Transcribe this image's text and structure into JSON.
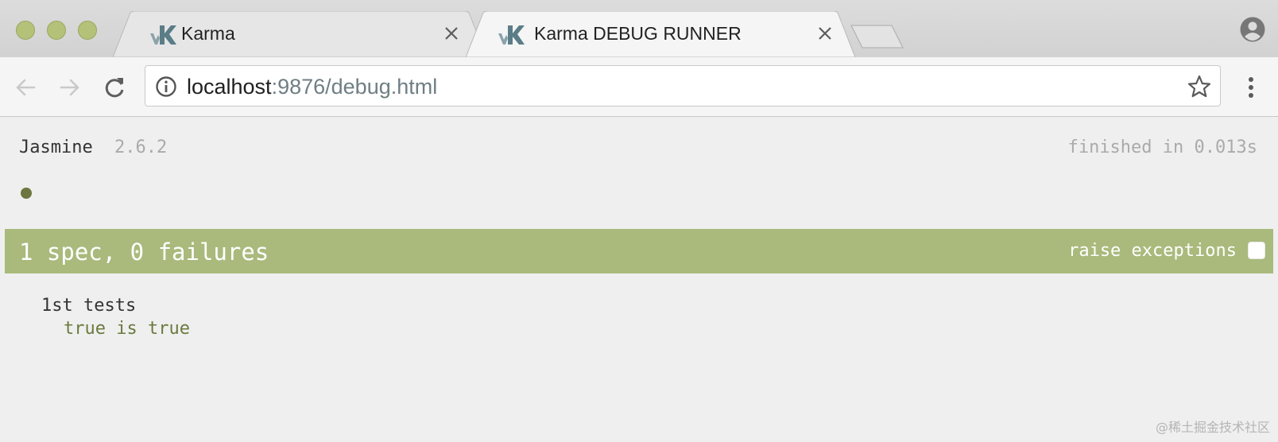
{
  "colors": {
    "pass_green": "#a9ba7c",
    "pass_text": "#6b7a3e",
    "dot": "#6e7640"
  },
  "browser": {
    "tabs": [
      {
        "title": "Karma",
        "icon": "karma-logo-icon",
        "active": false
      },
      {
        "title": "Karma DEBUG RUNNER",
        "icon": "karma-logo-icon",
        "active": true
      }
    ],
    "address": {
      "host": "localhost",
      "rest": ":9876/debug.html"
    }
  },
  "jasmine": {
    "title": "Jasmine",
    "version": "2.6.2",
    "duration": "finished in 0.013s",
    "summary": "1 spec, 0 failures",
    "raise_exceptions_label": "raise exceptions",
    "raise_exceptions_checked": false,
    "suites": [
      {
        "name": "1st tests",
        "specs": [
          {
            "name": "true is true",
            "status": "passed"
          }
        ]
      }
    ]
  },
  "watermark": "@稀土掘金技术社区"
}
